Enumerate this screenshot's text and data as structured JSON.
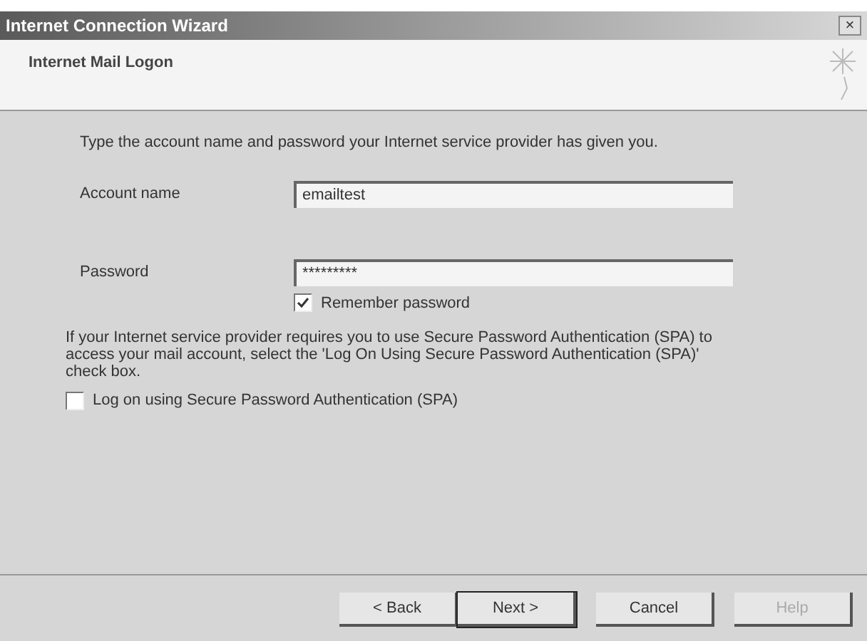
{
  "window": {
    "title": "Internet Connection Wizard",
    "close": "×"
  },
  "header": {
    "title": "Internet Mail Logon"
  },
  "intro": "Type the account name and password your Internet service provider has given you.",
  "fields": [
    {
      "label": "Account name",
      "value": "emailtest"
    },
    {
      "label": "Password",
      "value": "*********"
    }
  ],
  "remember": {
    "label": "Remember password",
    "checked": true
  },
  "spa_note": "If your Internet service provider requires you to use Secure Password Authentication (SPA) to access your mail account, select the 'Log On Using Secure Password Authentication (SPA)' check box.",
  "spa": {
    "label": "Log on using Secure Password Authentication (SPA)",
    "checked": false
  },
  "buttons": [
    {
      "label": "< Back",
      "default": false,
      "disabled": false
    },
    {
      "label": "Next >",
      "default": true,
      "disabled": false
    },
    {
      "label": "Cancel",
      "default": false,
      "disabled": false
    },
    {
      "label": "Help",
      "default": false,
      "disabled": true
    }
  ]
}
